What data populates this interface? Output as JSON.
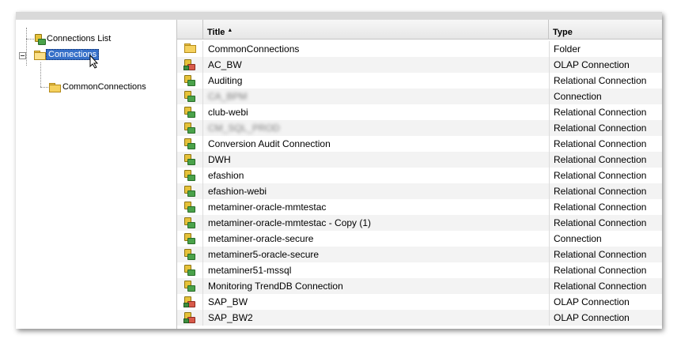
{
  "tree": {
    "nodes": [
      {
        "label": "Connections List",
        "icon": "connection-icon",
        "selected": false
      },
      {
        "label": "Connections",
        "icon": "open-folder-icon",
        "selected": true
      },
      {
        "label": "CommonConnections",
        "icon": "folder-icon",
        "selected": false
      }
    ]
  },
  "grid": {
    "columns": [
      {
        "label": "Title",
        "sort": "ascending"
      },
      {
        "label": "Type"
      }
    ],
    "rows": [
      {
        "icon": "folder-icon",
        "title": "CommonConnections",
        "type": "Folder",
        "blurred": false
      },
      {
        "icon": "olap-connection-icon",
        "title": "AC_BW",
        "type": "OLAP Connection",
        "blurred": false
      },
      {
        "icon": "relational-connection-icon",
        "title": "Auditing",
        "type": "Relational Connection",
        "blurred": false
      },
      {
        "icon": "relational-connection-icon",
        "title": "CA_BPM",
        "type": "Connection",
        "blurred": true
      },
      {
        "icon": "relational-connection-icon",
        "title": "club-webi",
        "type": "Relational Connection",
        "blurred": false
      },
      {
        "icon": "relational-connection-icon",
        "title": "CM_SQL_PROD",
        "type": "Relational Connection",
        "blurred": true
      },
      {
        "icon": "relational-connection-icon",
        "title": "Conversion Audit Connection",
        "type": "Relational Connection",
        "blurred": false
      },
      {
        "icon": "relational-connection-icon",
        "title": "DWH",
        "type": "Relational Connection",
        "blurred": false
      },
      {
        "icon": "relational-connection-icon",
        "title": "efashion",
        "type": "Relational Connection",
        "blurred": false
      },
      {
        "icon": "relational-connection-icon",
        "title": "efashion-webi",
        "type": "Relational Connection",
        "blurred": false
      },
      {
        "icon": "relational-connection-icon",
        "title": "metaminer-oracle-mmtestac",
        "type": "Relational Connection",
        "blurred": false
      },
      {
        "icon": "relational-connection-icon",
        "title": "metaminer-oracle-mmtestac - Copy (1)",
        "type": "Relational Connection",
        "blurred": false
      },
      {
        "icon": "relational-connection-icon",
        "title": "metaminer-oracle-secure",
        "type": "Connection",
        "blurred": false
      },
      {
        "icon": "relational-connection-icon",
        "title": "metaminer5-oracle-secure",
        "type": "Relational Connection",
        "blurred": false
      },
      {
        "icon": "relational-connection-icon",
        "title": "metaminer51-mssql",
        "type": "Relational Connection",
        "blurred": false
      },
      {
        "icon": "relational-connection-icon",
        "title": "Monitoring TrendDB Connection",
        "type": "Relational Connection",
        "blurred": false
      },
      {
        "icon": "olap-connection-icon",
        "title": "SAP_BW",
        "type": "OLAP Connection",
        "blurred": false
      },
      {
        "icon": "olap-connection-icon",
        "title": "SAP_BW2",
        "type": "OLAP Connection",
        "blurred": false
      }
    ]
  },
  "colors": {
    "selection": "#3670c9",
    "header_bg": "#e6e6e6",
    "alt_row": "#f3f3f3"
  }
}
